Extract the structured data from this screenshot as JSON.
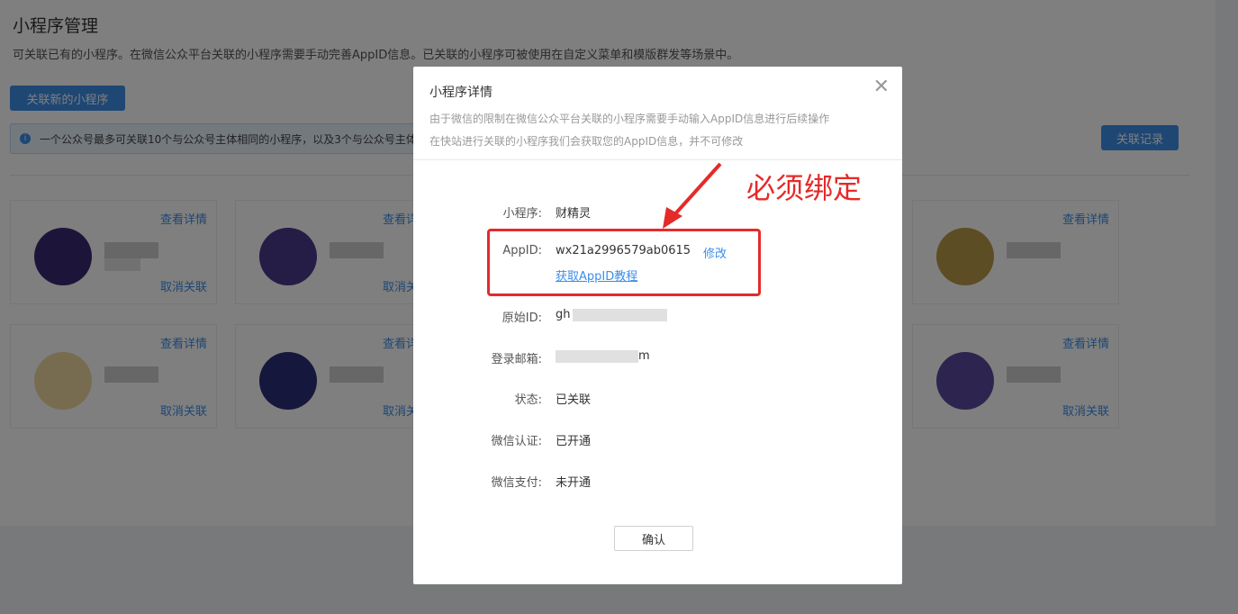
{
  "page": {
    "title": "小程序管理",
    "description": "可关联已有的小程序。在微信公众平台关联的小程序需要手动完善AppID信息。已关联的小程序可被使用在自定义菜单和模版群发等场景中。",
    "link_new_label": "关联新的小程序",
    "records_label": "关联记录",
    "notice": "一个公众号最多可关联10个与公众号主体相同的小程序，以及3个与公众号主体"
  },
  "cards": [
    {
      "detail": "查看详情",
      "unlink": "取消关联"
    },
    {
      "detail": "查看详",
      "unlink": "取消关"
    },
    {
      "detail": "查看详情",
      "unlink": ""
    },
    {
      "detail": "查看详情",
      "unlink": "取消关联"
    },
    {
      "detail": "查看详",
      "unlink": "取消关"
    },
    {
      "detail": "查看详情",
      "unlink": "取消关联"
    }
  ],
  "modal": {
    "title": "小程序详情",
    "subtitle_1": "由于微信的限制在微信公众平台关联的小程序需要手动输入AppID信息进行后续操作",
    "subtitle_2": "在快站进行关联的小程序我们会获取您的AppID信息，并不可修改",
    "fields": {
      "name_label": "小程序:",
      "name_value": "财精灵",
      "appid_label": "AppID:",
      "appid_value": "wx21a2996579ab0615",
      "edit_label": "修改",
      "tutorial_label": "获取AppID教程",
      "origin_label": "原始ID:",
      "origin_value_prefix": "gh",
      "email_label": "登录邮箱:",
      "email_value_suffix": "m",
      "status_label": "状态:",
      "status_value": "已关联",
      "cert_label": "微信认证:",
      "cert_value": "已开通",
      "pay_label": "微信支付:",
      "pay_value": "未开通"
    },
    "confirm_label": "确认"
  },
  "annotation": {
    "text": "必须绑定",
    "color": "#e52a2a"
  },
  "colors": {
    "accent": "#3c8ee8",
    "overlay": "rgba(0,0,0,0.5)"
  }
}
